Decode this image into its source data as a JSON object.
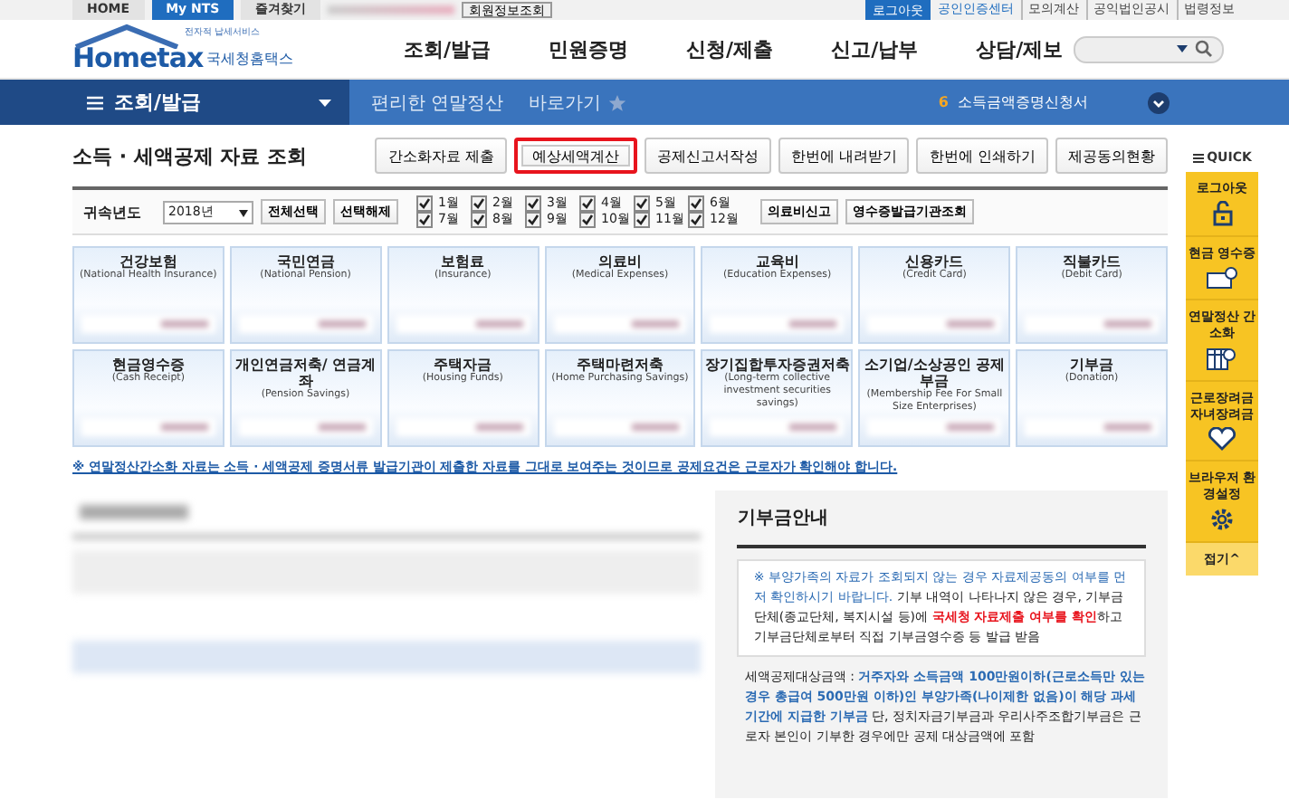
{
  "top_bar": {
    "links": [
      {
        "label": "HOME",
        "selected": false
      },
      {
        "label": "My NTS",
        "selected": true
      },
      {
        "label": "즐겨찾기",
        "selected": false
      }
    ],
    "member_button": "회원정보조회",
    "logout": "로그아웃",
    "cert_center": "공인인증센터",
    "right_links": [
      "모의계산",
      "공익법인공시",
      "법령정보"
    ]
  },
  "header": {
    "logo_small": "전자적 납세서비스",
    "logo": "Hometax",
    "logo_sub": "국세청홈택스",
    "menu": [
      "조회/발급",
      "민원증명",
      "신청/제출",
      "신고/납부",
      "상담/제보"
    ]
  },
  "nav": {
    "section": "조회/발급",
    "crumbs": [
      "편리한 연말정산",
      "바로가기"
    ],
    "ticker_number": "6",
    "ticker_text": "소득금액증명신청서"
  },
  "page_title": "소득 · 세액공제 자료 조회",
  "actions": [
    {
      "label": "간소화자료 제출",
      "highlighted": false
    },
    {
      "label": "예상세액계산",
      "highlighted": true
    },
    {
      "label": "공제신고서작성",
      "highlighted": false
    },
    {
      "label": "한번에 내려받기",
      "highlighted": false
    },
    {
      "label": "한번에 인쇄하기",
      "highlighted": false
    },
    {
      "label": "제공동의현황",
      "highlighted": false
    }
  ],
  "filter": {
    "label": "귀속년도",
    "year": "2018년",
    "select_all": "전체선택",
    "deselect": "선택해제",
    "months": [
      {
        "label": "1월",
        "checked": true
      },
      {
        "label": "2월",
        "checked": true
      },
      {
        "label": "3월",
        "checked": true
      },
      {
        "label": "4월",
        "checked": true
      },
      {
        "label": "5월",
        "checked": true
      },
      {
        "label": "6월",
        "checked": true
      },
      {
        "label": "7월",
        "checked": true
      },
      {
        "label": "8월",
        "checked": true
      },
      {
        "label": "9월",
        "checked": true
      },
      {
        "label": "10월",
        "checked": true
      },
      {
        "label": "11월",
        "checked": true
      },
      {
        "label": "12월",
        "checked": true
      }
    ],
    "buttons": [
      "의료비신고",
      "영수증발급기관조회"
    ]
  },
  "categories": [
    {
      "title": "건강보험",
      "english": "(National Health Insurance)"
    },
    {
      "title": "국민연금",
      "english": "(National Pension)"
    },
    {
      "title": "보험료",
      "english": "(Insurance)"
    },
    {
      "title": "의료비",
      "english": "(Medical Expenses)"
    },
    {
      "title": "교육비",
      "english": "(Education Expenses)"
    },
    {
      "title": "신용카드",
      "english": "(Credit Card)"
    },
    {
      "title": "직불카드",
      "english": "(Debit Card)"
    },
    {
      "title": "현금영수증",
      "english": "(Cash Receipt)"
    },
    {
      "title": "개인연금저축/ 연금계좌",
      "english": "(Pension Savings)"
    },
    {
      "title": "주택자금",
      "english": "(Housing Funds)"
    },
    {
      "title": "주택마련저축",
      "english": "(Home Purchasing Savings)"
    },
    {
      "title": "장기집합투자증권저축",
      "english": "(Long-term collective investment securities savings)"
    },
    {
      "title": "소기업/소상공인 공제부금",
      "english": "(Membership Fee For Small Size Enterprises)"
    },
    {
      "title": "기부금",
      "english": "(Donation)"
    }
  ],
  "notice": "※ 연말정산간소화 자료는 소득 · 세액공제 증명서류 발급기관이 제출한 자료를 그대로 보여주는 것이므로 공제요건은 근로자가 확인해야 합니다.",
  "donation_guide": {
    "title": "기부금안내",
    "box": [
      {
        "text": "※ 부양가족의 자료가 조회되지 않는 경우 자료제공동의 여부를 먼저 확인하시기 바랍니다.",
        "kind": "blue"
      },
      {
        "text": " 기부 내역이 나타나지 않은 경우, 기부금단체(종교단체, 복지시설 등)에 ",
        "kind": "plain"
      },
      {
        "text": "국세청 자료제출 여부를 확인",
        "kind": "red"
      },
      {
        "text": "하고 기부금단체로부터 직접 기부금영수증 등 발급 받음",
        "kind": "plain"
      }
    ],
    "bullet": [
      {
        "text": "세액공제대상금액 : ",
        "kind": "plain"
      },
      {
        "text": "거주자와 소득금액 100만원이하(근로소득만 있는 경우 총급여 500만원 이하)인 부양가족(나이제한 없음)이 해당 과세기간에 지급한 기부금",
        "kind": "blue"
      },
      {
        "text": " 단, 정치자금기부금과 우리사주조합기부금은 근로자 본인이 기부한 경우에만 공제 대상금액에 포함",
        "kind": "plain"
      }
    ]
  },
  "quick": {
    "title": "QUICK",
    "items": [
      {
        "label": "로그아웃",
        "kind": "lock"
      },
      {
        "label": "현금 영수증",
        "kind": "receipt"
      },
      {
        "label": "연말정산 간소화",
        "kind": "table"
      },
      {
        "label": "근로장려금 자녀장려금",
        "kind": "heart"
      },
      {
        "label": "브라우저 환경설정",
        "kind": "gear"
      }
    ],
    "collapse": "접기^"
  }
}
